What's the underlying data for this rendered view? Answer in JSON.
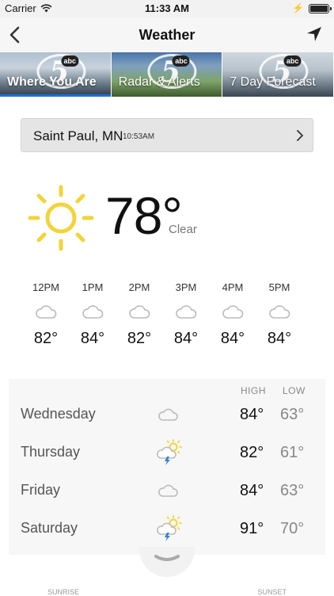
{
  "status": {
    "carrier": "Carrier",
    "time": "11:33 AM"
  },
  "nav": {
    "title": "Weather",
    "back_icon": "chevron-left-icon",
    "location_icon": "location-arrow-icon"
  },
  "tabs": [
    {
      "label": "Where You Are",
      "active": true
    },
    {
      "label": "Radar & Alerts",
      "active": false
    },
    {
      "label": "7 Day Forecast",
      "active": false
    }
  ],
  "logo": {
    "number": "5",
    "network": "abc"
  },
  "colors": {
    "accent": "#1f6fd6",
    "sun": "#f2d43a"
  },
  "location": {
    "city": "Saint Paul, MN",
    "time": "10:53AM"
  },
  "current": {
    "temp": "78°",
    "condition": "Clear",
    "icon": "sun-icon"
  },
  "hourly": [
    {
      "time": "12PM",
      "temp": "82°",
      "icon": "cloud-icon"
    },
    {
      "time": "1PM",
      "temp": "84°",
      "icon": "cloud-icon"
    },
    {
      "time": "2PM",
      "temp": "82°",
      "icon": "cloud-icon"
    },
    {
      "time": "3PM",
      "temp": "84°",
      "icon": "cloud-icon"
    },
    {
      "time": "4PM",
      "temp": "84°",
      "icon": "cloud-icon"
    },
    {
      "time": "5PM",
      "temp": "84°",
      "icon": "cloud-icon"
    }
  ],
  "daily": {
    "high_label": "HIGH",
    "low_label": "LOW",
    "days": [
      {
        "name": "Wednesday",
        "high": "84°",
        "low": "63°",
        "icon": "cloud-icon"
      },
      {
        "name": "Thursday",
        "high": "82°",
        "low": "61°",
        "icon": "thunderstorm-sun-icon"
      },
      {
        "name": "Friday",
        "high": "84°",
        "low": "63°",
        "icon": "cloud-icon"
      },
      {
        "name": "Saturday",
        "high": "91°",
        "low": "70°",
        "icon": "thunderstorm-sun-icon"
      }
    ]
  },
  "bottom": {
    "sunrise_label": "SUNRISE",
    "sunset_label": "SUNSET"
  }
}
